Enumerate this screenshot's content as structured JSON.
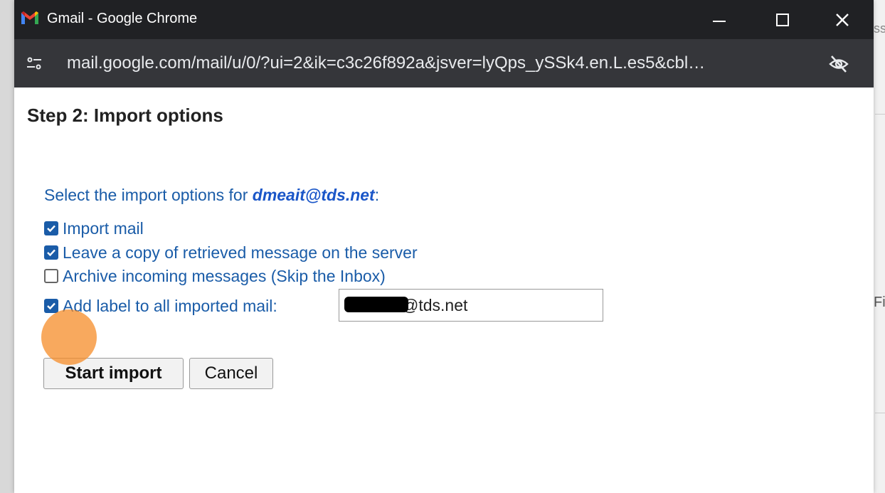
{
  "window": {
    "title": "Gmail - Google Chrome",
    "url": "mail.google.com/mail/u/0/?ui=2&ik=c3c26f892a&jsver=lyQps_ySSk4.en.L.es5&cbl…"
  },
  "background": {
    "right_text_1": "ss",
    "right_text_2": "Fi"
  },
  "dialog": {
    "title": "Step 2: Import options",
    "select_prefix": "Select the import options for ",
    "account": "dmeait@tds.net",
    "select_suffix": ":",
    "options": [
      {
        "label": "Import mail",
        "checked": true
      },
      {
        "label": "Leave a copy of retrieved message on the server",
        "checked": true
      },
      {
        "label": "Archive incoming messages (Skip the Inbox)",
        "checked": false
      },
      {
        "label": "Add label to all imported mail:",
        "checked": true
      }
    ],
    "label_value": "@tds.net",
    "start_button": "Start import",
    "cancel_button": "Cancel"
  },
  "colors": {
    "link_blue": "#1a5ca8",
    "titlebar": "#202124",
    "addressbar": "#35363a",
    "click_marker": "#f58c28"
  }
}
